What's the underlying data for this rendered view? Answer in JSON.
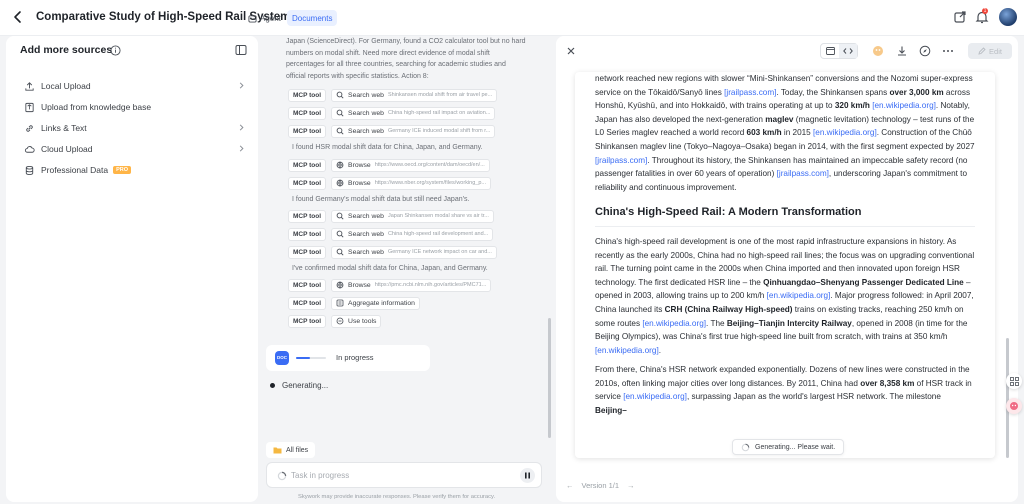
{
  "header": {
    "title": "Comparative Study of High-Speed Rail Systems",
    "agent_label": "Agent",
    "docs_label": "Documents",
    "notification_count": "1"
  },
  "sources": {
    "title": "Add more sources",
    "items": [
      {
        "label": "Local Upload",
        "icon": "upload-icon",
        "has_chevron": true
      },
      {
        "label": "Upload from knowledge base",
        "icon": "knowledge-icon",
        "has_chevron": false
      },
      {
        "label": "Links & Text",
        "icon": "link-icon",
        "has_chevron": true
      },
      {
        "label": "Cloud Upload",
        "icon": "cloud-icon",
        "has_chevron": true
      },
      {
        "label": "Professional Data",
        "icon": "database-icon",
        "has_chevron": false,
        "tag": "PRO"
      }
    ]
  },
  "chat": {
    "intro": "Japan (ScienceDirect). For Germany, found a CO2 calculator tool but no hard numbers on modal shift. Need more direct evidence of modal shift percentages for all three countries, searching for academic studies and official reports with specific statistics. Action 8:",
    "tool_label": "MCP tool",
    "steps": [
      {
        "type": "tool",
        "action": "Search web",
        "detail": "Shinkansen modal shift from air travel pe..."
      },
      {
        "type": "tool",
        "action": "Search web",
        "detail": "China high-speed rail impact on aviation..."
      },
      {
        "type": "tool",
        "action": "Search web",
        "detail": "Germany ICE induced modal shift from r..."
      },
      {
        "type": "text",
        "text": "I found HSR modal shift data for China, Japan, and Germany."
      },
      {
        "type": "tool",
        "action": "Browse",
        "detail": "https://www.oecd.org/content/dam/oecd/en/..."
      },
      {
        "type": "tool",
        "action": "Browse",
        "detail": "https://www.nber.org/system/files/working_p..."
      },
      {
        "type": "text",
        "text": "I found Germany's modal shift data but still need Japan's."
      },
      {
        "type": "tool",
        "action": "Search web",
        "detail": "Japan Shinkansen modal share vs air tr..."
      },
      {
        "type": "tool",
        "action": "Search web",
        "detail": "China high-speed rail development and..."
      },
      {
        "type": "tool",
        "action": "Search web",
        "detail": "Germany ICE network impact on car and..."
      },
      {
        "type": "text",
        "text": "I've confirmed modal shift data for China, Japan, and Germany."
      },
      {
        "type": "tool",
        "action": "Browse",
        "detail": "https://pmc.ncbi.nlm.nih.gov/articles/PMC71..."
      },
      {
        "type": "tool",
        "action": "Aggregate information",
        "detail": ""
      },
      {
        "type": "tool",
        "action": "Use tools",
        "detail": ""
      }
    ],
    "progress_icon": "DOC",
    "progress_text": "In progress",
    "progress_fraction": 0.45,
    "generating_text": "Generating...",
    "all_files_label": "All files",
    "task_placeholder": "Task in progress",
    "disclaimer": "Skywork may provide inaccurate responses. Please verify them for accuracy."
  },
  "document": {
    "edit_label": "Edit",
    "para1": [
      {
        "t": "network reached new regions with slower “Mini-Shinkansen” conversions and the Nozomi super-express service on the Tōkaidō/Sanyō lines "
      },
      {
        "t": "[jrailpass.com]",
        "link": true
      },
      {
        "t": ". Today, the Shinkansen spans "
      },
      {
        "t": "over 3,000 km",
        "b": true
      },
      {
        "t": " across Honshū, Kyūshū, and into Hokkaidō, with trains operating at up to "
      },
      {
        "t": "320 km/h",
        "b": true
      },
      {
        "t": " "
      },
      {
        "t": "[en.wikipedia.org]",
        "link": true
      },
      {
        "t": ". Notably, Japan has also developed the next-generation "
      },
      {
        "t": "maglev",
        "b": true
      },
      {
        "t": " (magnetic levitation) technology – test runs of the L0 Series maglev reached a world record "
      },
      {
        "t": "603 km/h",
        "b": true
      },
      {
        "t": " in 2015 "
      },
      {
        "t": "[en.wikipedia.org]",
        "link": true
      },
      {
        "t": ". Construction of the Chūō Shinkansen maglev line (Tokyo–Nagoya–Osaka) began in 2014, with the first segment expected by 2027 "
      },
      {
        "t": "[jrailpass.com]",
        "link": true
      },
      {
        "t": ". Throughout its history, the Shinkansen has maintained an impeccable safety record (no passenger fatalities in over 60 years of operation) "
      },
      {
        "t": "[jrailpass.com]",
        "link": true
      },
      {
        "t": ", underscoring Japan's commitment to reliability and continuous improvement."
      }
    ],
    "heading": "China's High-Speed Rail: A Modern Transformation",
    "para2": [
      {
        "t": "China's high-speed rail development is one of the most rapid infrastructure expansions in history. As recently as the early 2000s, China had no high-speed rail lines; the focus was on upgrading conventional rail. The turning point came in the 2000s when China imported and then innovated upon foreign HSR technology. The first dedicated HSR line – the "
      },
      {
        "t": "Qinhuangdao–Shenyang Passenger Dedicated Line",
        "b": true
      },
      {
        "t": " – opened in 2003, allowing trains up to 200 km/h "
      },
      {
        "t": "[en.wikipedia.org]",
        "link": true
      },
      {
        "t": ". Major progress followed: in April 2007, China launched its "
      },
      {
        "t": "CRH (China Railway High-speed)",
        "b": true
      },
      {
        "t": " trains on existing tracks, reaching 250 km/h on some routes "
      },
      {
        "t": "[en.wikipedia.org]",
        "link": true
      },
      {
        "t": ". The "
      },
      {
        "t": "Beijing–Tianjin Intercity Railway",
        "b": true
      },
      {
        "t": ", opened in 2008 (in time for the Beijing Olympics), was China's first true high-speed line built from scratch, with trains at 350 km/h "
      },
      {
        "t": "[en.wikipedia.org]",
        "link": true
      },
      {
        "t": "."
      }
    ],
    "para3": [
      {
        "t": "From there, China's HSR network expanded exponentially. Dozens of new lines were constructed in the 2010s, often linking major cities over long distances. By 2011, China had "
      },
      {
        "t": "over 8,358 km",
        "b": true
      },
      {
        "t": " of HSR track in service "
      },
      {
        "t": "[en.wikipedia.org]",
        "link": true
      },
      {
        "t": ", surpassing Japan as the world's largest HSR network. The milestone "
      },
      {
        "t": "Beijing–",
        "b": true
      }
    ],
    "generating_wait": "Generating... Please wait.",
    "version": "Version 1/1"
  },
  "colors": {
    "accent": "#3a6cf4",
    "pro_tag": "#ffb547",
    "badge": "#f04438"
  }
}
